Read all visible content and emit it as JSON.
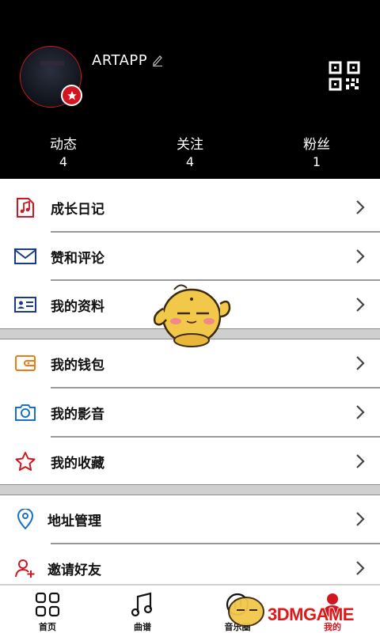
{
  "profile": {
    "username": "ARTAPP",
    "stats": [
      {
        "label": "动态",
        "value": "4"
      },
      {
        "label": "关注",
        "value": "4"
      },
      {
        "label": "粉丝",
        "value": "1"
      }
    ]
  },
  "menu": {
    "group1": [
      {
        "label": "成长日记",
        "icon": "music-note-icon",
        "color": "#d2151e"
      },
      {
        "label": "赞和评论",
        "icon": "mail-icon",
        "color": "#1a3a8a"
      },
      {
        "label": "我的资料",
        "icon": "id-card-icon",
        "color": "#1a3a8a"
      }
    ],
    "group2": [
      {
        "label": "我的钱包",
        "icon": "wallet-icon",
        "color": "#f07a10"
      },
      {
        "label": "我的影音",
        "icon": "camera-icon",
        "color": "#1a6fc8"
      },
      {
        "label": "我的收藏",
        "icon": "star-icon",
        "color": "#d2151e"
      }
    ],
    "group3": [
      {
        "label": "地址管理",
        "icon": "location-pin-icon",
        "color": "#1a6fc8"
      },
      {
        "label": "邀请好友",
        "icon": "add-friend-icon",
        "color": "#d2151e"
      }
    ]
  },
  "tabbar": {
    "tabs": [
      {
        "label": "首页",
        "icon": "grid-icon"
      },
      {
        "label": "曲谱",
        "icon": "music-note-icon"
      },
      {
        "label": "音乐圈",
        "icon": "music-circle-icon"
      },
      {
        "label": "我的",
        "icon": "person-icon",
        "active": true
      }
    ]
  },
  "watermark": {
    "text": "3DMGAME"
  }
}
